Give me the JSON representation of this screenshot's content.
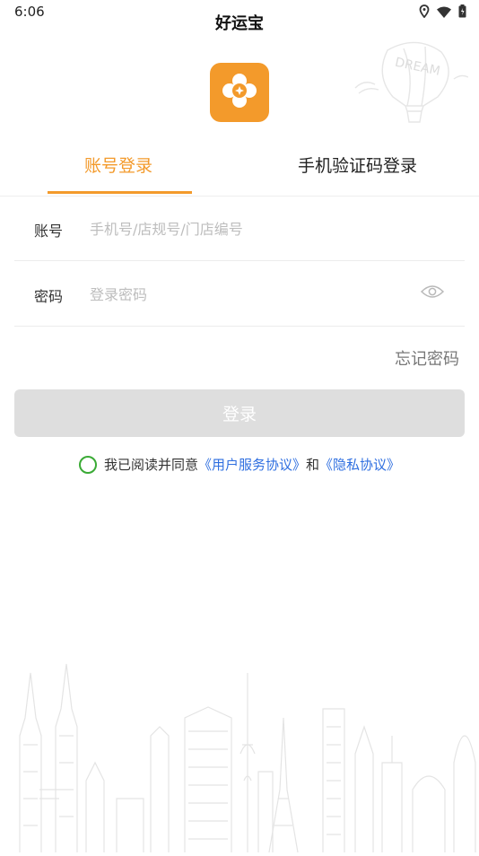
{
  "status_bar": {
    "time": "6:06"
  },
  "app_title": "好运宝",
  "tabs": [
    {
      "label": "账号登录",
      "active": true
    },
    {
      "label": "手机验证码登录",
      "active": false
    }
  ],
  "form": {
    "account_label": "账号",
    "account_placeholder": "手机号/店规号/门店编号",
    "account_value": "",
    "password_label": "密码",
    "password_placeholder": "登录密码",
    "password_value": ""
  },
  "forgot_password": "忘记密码",
  "login_button": "登录",
  "agreement": {
    "prefix": "我已阅读并同意",
    "user_agreement": "《用户服务协议》",
    "and": "和",
    "privacy_agreement": "《隐私协议》",
    "checked": false
  },
  "decoration": {
    "balloon_text": "DREAM"
  },
  "colors": {
    "accent": "#f39a2b",
    "link": "#2f6fe0",
    "check_ring": "#3aaa35",
    "disabled_button": "#dedede"
  },
  "icons": [
    "location-icon",
    "wifi-icon",
    "battery-icon",
    "app-logo-icon",
    "eye-icon",
    "checkbox-circle-icon"
  ]
}
